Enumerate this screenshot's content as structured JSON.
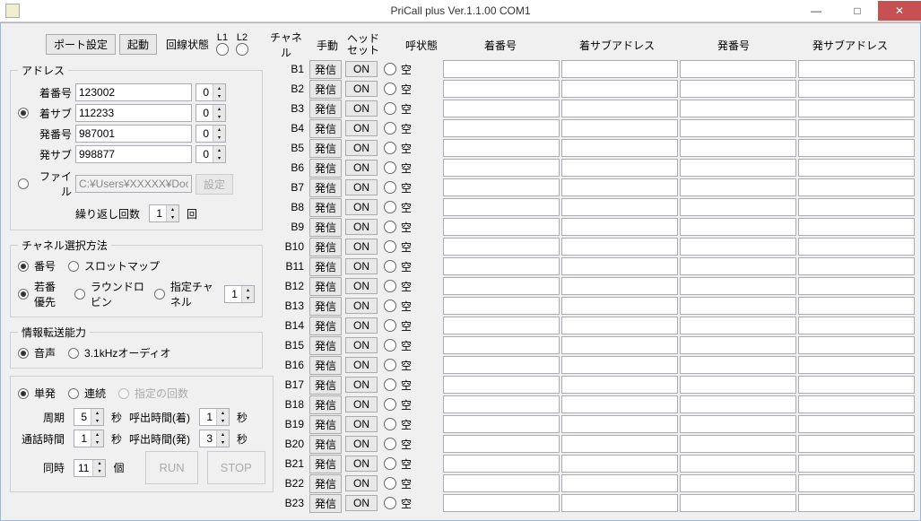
{
  "window": {
    "title": "PriCall plus Ver.1.1.00 COM1",
    "min": "—",
    "max": "□",
    "close": "✕"
  },
  "top": {
    "portSettings": "ポート設定",
    "start": "起動",
    "lineStatus": "回線状態",
    "L1": "L1",
    "L2": "L2"
  },
  "address": {
    "legend": "アドレス",
    "calledNum": "着番号",
    "calledNumVal": "123002",
    "calledSub": "着サブ",
    "calledSubVal": "112233",
    "callingNum": "発番号",
    "callingNumVal": "987001",
    "callingSub": "発サブ",
    "callingSubVal": "998877",
    "file": "ファイル",
    "filePath": "C:¥Users¥XXXXX¥Docun",
    "fileSet": "設定",
    "repeat": "繰り返し回数",
    "repeatVal": "1",
    "repeatUnit": "回",
    "combo0": "0"
  },
  "channelSel": {
    "legend": "チャネル選択方法",
    "number": "番号",
    "slotmap": "スロットマップ",
    "youngFirst": "若番優先",
    "roundRobin": "ラウンドロビン",
    "specChannel": "指定チャネル",
    "specVal": "1"
  },
  "infoTransfer": {
    "legend": "情報転送能力",
    "voice": "音声",
    "audio31k": "3.1kHzオーディオ"
  },
  "mode": {
    "single": "単発",
    "continuous": "連続",
    "specCount": "指定の回数"
  },
  "timing": {
    "period": "周期",
    "periodVal": "5",
    "sec": "秒",
    "ringIn": "呼出時間(着)",
    "ringInVal": "1",
    "talk": "通話時間",
    "talkVal": "1",
    "ringOut": "呼出時間(発)",
    "ringOutVal": "3",
    "concurrent": "同時",
    "concurrentVal": "11",
    "unit": "個",
    "run": "RUN",
    "stop": "STOP"
  },
  "grid": {
    "hChannel": "チャネル",
    "hManual": "手動",
    "hHeadset1": "ヘッド",
    "hHeadset2": "セット",
    "hCallState": "呼状態",
    "hCalledNum": "着番号",
    "hCalledSub": "着サブアドレス",
    "hCallingNum": "発番号",
    "hCallingSub": "発サブアドレス",
    "hassin": "発信",
    "on": "ON",
    "empty": "空",
    "channels": [
      "B1",
      "B2",
      "B3",
      "B4",
      "B5",
      "B6",
      "B7",
      "B8",
      "B9",
      "B10",
      "B11",
      "B12",
      "B13",
      "B14",
      "B15",
      "B16",
      "B17",
      "B18",
      "B19",
      "B20",
      "B21",
      "B22",
      "B23"
    ]
  }
}
